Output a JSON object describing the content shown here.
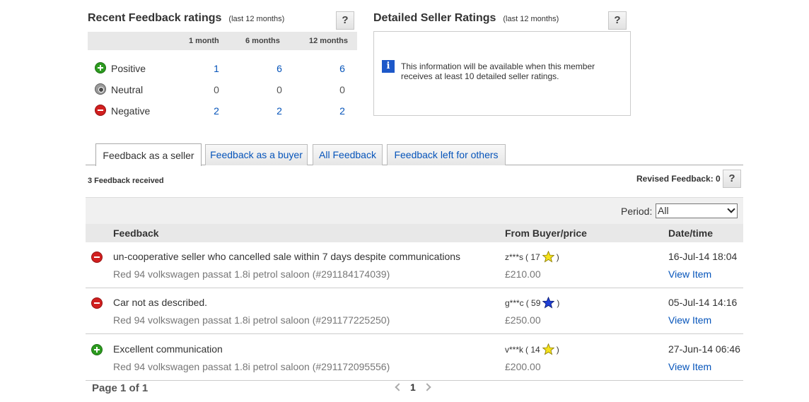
{
  "recent": {
    "title": "Recent Feedback ratings",
    "subtitle": "(last 12 months)",
    "help": "?",
    "columns": [
      "1 month",
      "6 months",
      "12 months"
    ],
    "rows": [
      {
        "label": "Positive",
        "icon": "positive-icon",
        "values": [
          "1",
          "6",
          "6"
        ]
      },
      {
        "label": "Neutral",
        "icon": "neutral-icon",
        "values": [
          "0",
          "0",
          "0"
        ]
      },
      {
        "label": "Negative",
        "icon": "negative-icon",
        "values": [
          "2",
          "2",
          "2"
        ]
      }
    ]
  },
  "dsr": {
    "title": "Detailed Seller Ratings",
    "subtitle": "(last 12 months)",
    "help": "?",
    "info_text": "This information will be available when this member receives at least 10 detailed seller ratings."
  },
  "tabs": [
    {
      "label": "Feedback as a seller",
      "active": true
    },
    {
      "label": "Feedback as a buyer",
      "active": false
    },
    {
      "label": "All Feedback",
      "active": false
    },
    {
      "label": "Feedback left for others",
      "active": false
    }
  ],
  "summary": {
    "count_text": "3 Feedback received",
    "revised_text": "Revised Feedback: 0",
    "help": "?"
  },
  "period": {
    "label": "Period:",
    "selected": "All"
  },
  "table": {
    "headers": [
      "Feedback",
      "From Buyer/price",
      "Date/time"
    ],
    "rows": [
      {
        "type": "negative",
        "comment": "un-cooperative seller who cancelled sale within 7 days despite communications",
        "item": "Red 94 volkswagen passat 1.8i petrol saloon (#291184174039)",
        "user": "z***s",
        "score_open": "( 17",
        "score_close": ")",
        "star_color": "#f5e21b",
        "price": "£210.00",
        "date": "16-Jul-14 18:04",
        "view": "View Item"
      },
      {
        "type": "negative",
        "comment": "Car not as described.",
        "item": "Red 94 volkswagen passat 1.8i petrol saloon (#291177225250)",
        "user": "g***c",
        "score_open": "( 59",
        "score_close": ")",
        "star_color": "#1f3fd6",
        "price": "£250.00",
        "date": "05-Jul-14 14:16",
        "view": "View Item"
      },
      {
        "type": "positive",
        "comment": "Excellent communication",
        "item": "Red 94 volkswagen passat 1.8i petrol saloon (#291172095556)",
        "user": "v***k",
        "score_open": "( 14",
        "score_close": ")",
        "star_color": "#f5e21b",
        "price": "£200.00",
        "date": "27-Jun-14 06:46",
        "view": "View Item"
      }
    ]
  },
  "pager": {
    "title": "Page 1 of 1",
    "current": "1"
  }
}
